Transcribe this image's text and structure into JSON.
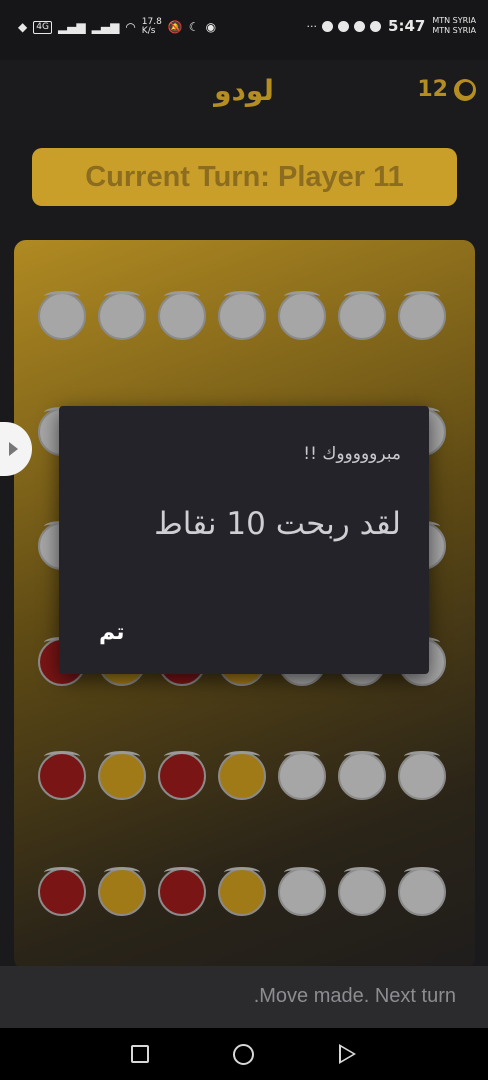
{
  "status_bar": {
    "network_badge": "4G",
    "speed_value": "17.8",
    "speed_unit": "K/s",
    "more_dots": "···",
    "time": "5:47",
    "carrier_1": "MTN SYRIA",
    "carrier_2": "MTN SYRIA"
  },
  "app_bar": {
    "title": "لودو",
    "timer_value": "12"
  },
  "turn_banner": {
    "text": "Current Turn: Player 11"
  },
  "board": {
    "rows": [
      [
        "empty",
        "empty",
        "empty",
        "empty",
        "empty",
        "empty",
        "empty"
      ],
      [
        "empty",
        "empty",
        "empty",
        "empty",
        "empty",
        "empty",
        "empty"
      ],
      [
        "empty",
        "empty",
        "empty",
        "empty",
        "empty",
        "empty",
        "empty"
      ],
      [
        "red",
        "yellow",
        "red",
        "yellow",
        "empty",
        "empty",
        "empty"
      ],
      [
        "red",
        "yellow",
        "red",
        "yellow",
        "empty",
        "empty",
        "empty"
      ],
      [
        "red",
        "yellow",
        "red",
        "yellow",
        "empty",
        "empty",
        "empty"
      ]
    ]
  },
  "dialog": {
    "title": "مبروووووك !!",
    "message": "لقد ربحت 10 نقاط",
    "ok_label": "تم"
  },
  "bottom_status": {
    "text": ".Move made. Next turn"
  },
  "colors": {
    "accent_gold": "#b58e21",
    "piece_red": "#7a1515",
    "piece_yellow": "#a17a18",
    "piece_empty": "#a6a6a6"
  }
}
